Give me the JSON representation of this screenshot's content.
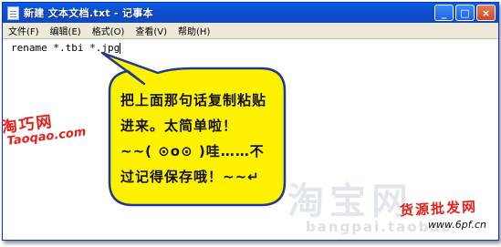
{
  "window": {
    "title": "新建 文本文档.txt - 记事本",
    "controls": [
      "_",
      "□",
      "×"
    ]
  },
  "menu": [
    "文件(F)",
    "编辑(E)",
    "格式(O)",
    "查看(V)",
    "帮助(H)"
  ],
  "editor": {
    "content": "rename *.tbi *.jpg"
  },
  "callout": {
    "lines": [
      "把上面那句话复制粘贴",
      "进来。太简单啦！",
      "~~(  ⊙o⊙  )哇……不",
      "过记得保存哦！~~↵"
    ]
  },
  "watermarks": {
    "left_cn": "淘巧网",
    "left_en": "Taoqao.com",
    "right_cn": "货源批发网",
    "right_url": "www.6pf.cn",
    "faint_cn": "淘宝网",
    "faint_en": "bangpai.taobao"
  },
  "colors": {
    "titlebar": "#0d4fd0",
    "bubble_fill": "#fff200",
    "bubble_stroke": "#1f3a93",
    "watermark_red": "#e3211a"
  }
}
